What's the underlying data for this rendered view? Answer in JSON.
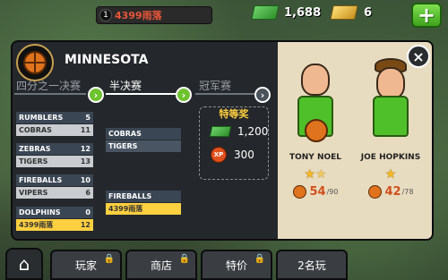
{
  "topbar": {
    "player_level": "1",
    "player_name": "4399雨落",
    "cash": "1,688",
    "gold": "6",
    "plus_label": "+"
  },
  "team": {
    "name": "MINNESOTA"
  },
  "rounds": [
    {
      "label": "四分之一决赛"
    },
    {
      "label": "半决赛"
    },
    {
      "label": "冠军赛"
    }
  ],
  "quarterfinals": [
    {
      "top": {
        "team": "RUMBLERS",
        "score": "5"
      },
      "bottom": {
        "team": "COBRAS",
        "score": "11"
      }
    },
    {
      "top": {
        "team": "ZEBRAS",
        "score": "12"
      },
      "bottom": {
        "team": "TIGERS",
        "score": "13"
      }
    },
    {
      "top": {
        "team": "FIREBALLS",
        "score": "10"
      },
      "bottom": {
        "team": "VIPERS",
        "score": "6"
      }
    },
    {
      "top": {
        "team": "DOLPHINS",
        "score": "0"
      },
      "bottom": {
        "team": "4399雨落",
        "score": "12"
      }
    }
  ],
  "semifinals": [
    {
      "top": "COBRAS",
      "bottom": "TIGERS"
    },
    {
      "top": "FIREBALLS",
      "bottom": "4399雨落"
    }
  ],
  "prize": {
    "title": "特等奖",
    "cash": "1,200",
    "xp_label": "XP",
    "xp": "300"
  },
  "players": [
    {
      "name": "TONY NOEL",
      "stars": 1.5,
      "rating": "54",
      "max": "/90",
      "skin": "#f0b890",
      "hair": "none"
    },
    {
      "name": "JOE HOPKINS",
      "stars": 1,
      "rating": "42",
      "max": "/78",
      "skin": "#f0b890",
      "hair": "brown"
    }
  ],
  "close_label": "×",
  "nav": {
    "home_icon": "home-icon",
    "tabs": [
      {
        "label": "玩家",
        "locked": true
      },
      {
        "label": "商店",
        "locked": true
      },
      {
        "label": "特价",
        "locked": true
      },
      {
        "label": "2名玩",
        "locked": false
      }
    ]
  },
  "colors": {
    "accent_green": "#6ec22e",
    "highlight_yellow": "#ffd040",
    "panel_dark": "#24282c",
    "card_bg": "#e8dcc0"
  }
}
